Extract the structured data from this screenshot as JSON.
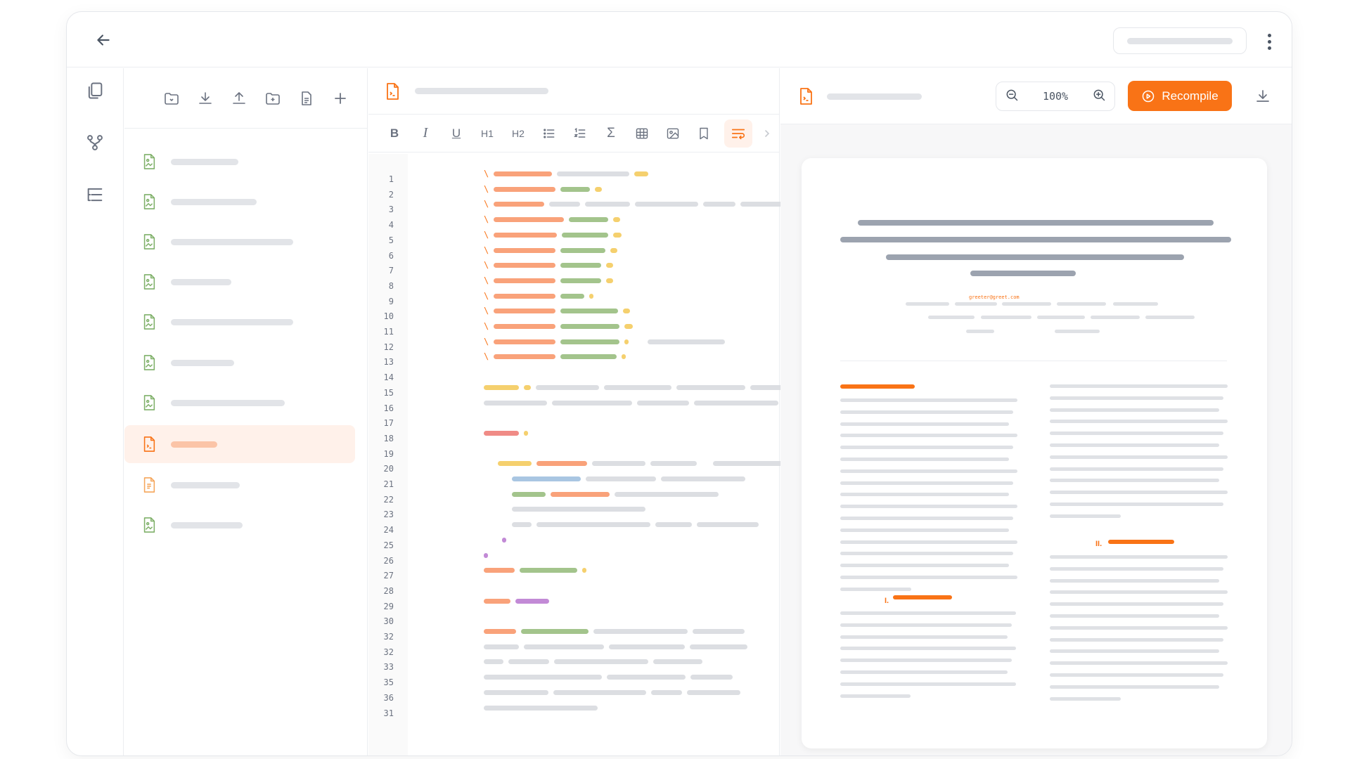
{
  "topbar": {
    "back_icon": "arrow-left-icon",
    "menu_icon": "more-vertical-icon"
  },
  "rail": {
    "icons": [
      "files-icon",
      "git-branch-icon",
      "outline-icon"
    ]
  },
  "files": {
    "toolbar_icons": [
      "folder-sync-icon",
      "download-icon",
      "upload-icon",
      "new-folder-icon",
      "new-file-icon",
      "plus-icon"
    ],
    "selected_index": 7
  },
  "editor": {
    "format_toolbar": [
      "B",
      "I",
      "U",
      "H1",
      "H2",
      "bullet-list-icon",
      "numbered-list-icon",
      "Σ",
      "table-icon",
      "image-icon",
      "bookmark-icon",
      "wrap-icon"
    ],
    "line_numbers": [
      "1",
      "2",
      "3",
      "4",
      "5",
      "6",
      "7",
      "8",
      "9",
      "10",
      "11",
      "12",
      "13",
      "14",
      "15",
      "16",
      "17",
      "18",
      "19",
      "20",
      "21",
      "22",
      "23",
      "24",
      "25",
      "26",
      "27",
      "28",
      "29",
      "30",
      "32",
      "32",
      "33",
      "35",
      "36",
      "31"
    ]
  },
  "preview": {
    "zoom_level": "100%",
    "recompile_label": "Recompile",
    "email": "greeter@greet.com",
    "section_1": "I.",
    "section_2": "II."
  },
  "colors": {
    "accent": "#f97316",
    "icon_green": "#7fb069"
  }
}
